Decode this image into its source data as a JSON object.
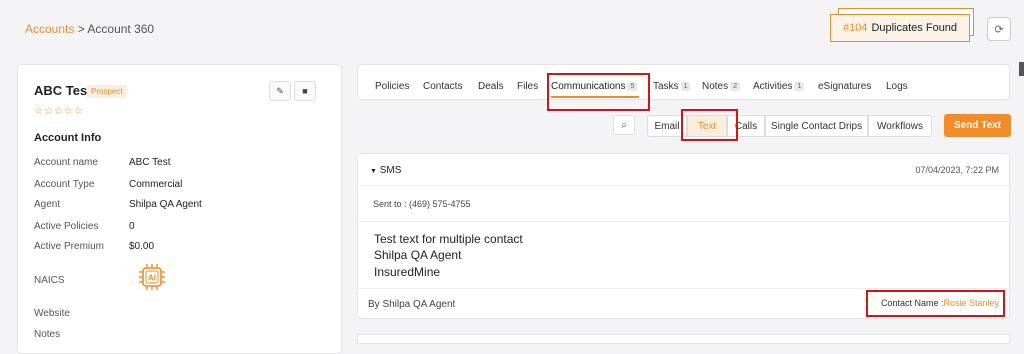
{
  "breadcrumb": {
    "parent": "Accounts",
    "separator": ">",
    "current": "Account 360"
  },
  "duplicates": {
    "number": "#104",
    "label": "Duplicates Found"
  },
  "account": {
    "name": "ABC Test",
    "status": "Prospect",
    "stars": "☆☆☆☆☆",
    "section_title": "Account Info",
    "rows": [
      {
        "label": "Account name",
        "value": "ABC Test"
      },
      {
        "label": "Account Type",
        "value": "Commercial"
      },
      {
        "label": "Agent",
        "value": "Shilpa QA Agent"
      },
      {
        "label": "Active Policies",
        "value": "0"
      },
      {
        "label": "Active Premium",
        "value": "$0.00"
      },
      {
        "label": "NAICS",
        "value": ""
      },
      {
        "label": "Website",
        "value": ""
      },
      {
        "label": "Notes",
        "value": ""
      }
    ],
    "ai_label": "AI"
  },
  "tabs": [
    {
      "label": "Policies"
    },
    {
      "label": "Contacts"
    },
    {
      "label": "Deals"
    },
    {
      "label": "Files"
    },
    {
      "label": "Communications",
      "badge": "5"
    },
    {
      "label": "Tasks",
      "badge": "1"
    },
    {
      "label": "Notes",
      "badge": "2"
    },
    {
      "label": "Activities",
      "badge": "1"
    },
    {
      "label": "eSignatures"
    },
    {
      "label": "Logs"
    }
  ],
  "comm_types": [
    "Email",
    "Text",
    "Calls",
    "Single Contact Drips",
    "Workflows"
  ],
  "send_button": "Send Text",
  "sms": {
    "title": "SMS",
    "date": "07/04/2023, 7:22 PM",
    "sent_to": "Sent to : (469) 575-4755",
    "message_lines": [
      "Test text for multiple contact",
      "Shilpa QA Agent",
      "InsuredMine"
    ],
    "by": "By Shilpa QA Agent",
    "contact_label": "Contact Name :",
    "contact_name": "Rosie Stanley"
  },
  "colors": {
    "accent": "#e98d2c",
    "annotation": "#d3121a"
  }
}
